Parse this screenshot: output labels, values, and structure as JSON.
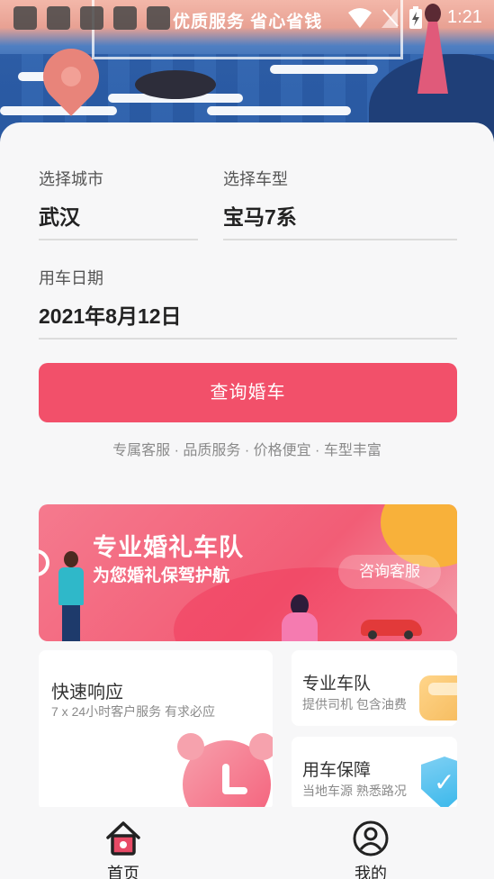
{
  "status_bar": {
    "app_banner_text": "优质服务 省心省钱",
    "time": "1:21",
    "icons": [
      "wifi-icon",
      "signal-off-icon",
      "battery-charging-icon"
    ]
  },
  "form": {
    "city_label": "选择城市",
    "city_value": "武汉",
    "model_label": "选择车型",
    "model_value": "宝马7系",
    "date_label": "用车日期",
    "date_value": "2021年8月12日",
    "query_button": "查询婚车"
  },
  "features_line": "专属客服 · 品质服务 · 价格便宜 · 车型丰富",
  "promo_banner": {
    "title": "专业婚礼车队",
    "subtitle": "为您婚礼保驾护航",
    "cta": "咨询客服"
  },
  "services": [
    {
      "title": "快速响应",
      "desc": "7 x 24小时客户服务 有求必应",
      "icon": "alarm-clock-icon"
    },
    {
      "title": "专业车队",
      "desc": "提供司机 包含油费",
      "icon": "car-icon"
    },
    {
      "title": "用车保障",
      "desc": "当地车源 熟悉路况",
      "icon": "shield-check-icon"
    }
  ],
  "bottom_nav": [
    {
      "label": "首页",
      "icon": "home-icon",
      "active": true
    },
    {
      "label": "我的",
      "icon": "user-icon",
      "active": false
    }
  ],
  "colors": {
    "accent": "#f2506a",
    "nav_active": "#e84a66"
  }
}
